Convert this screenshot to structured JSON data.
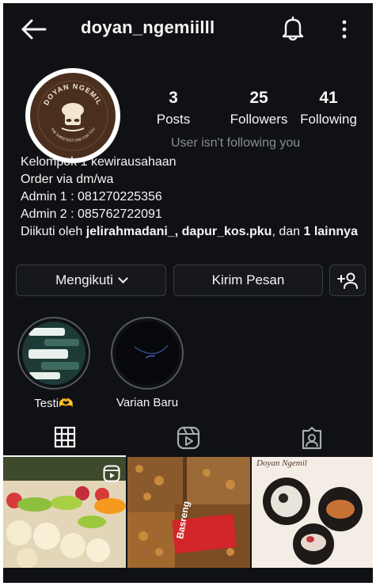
{
  "header": {
    "username": "doyan_ngemiilll",
    "icons": [
      "back-arrow-icon",
      "bell-icon",
      "more-vertical-icon"
    ]
  },
  "avatar": {
    "logo_text_top": "DOYAN NGEMIL",
    "logo_text_bottom": "THE SWEETEST ONE FOR YOU"
  },
  "stats": {
    "posts": {
      "value": "3",
      "label": "Posts"
    },
    "followers": {
      "value": "25",
      "label": "Followers"
    },
    "following": {
      "value": "41",
      "label": "Following"
    }
  },
  "follow_status": "User isn't following you",
  "bio": {
    "line1": "Kelompok 1 kewirausahaan",
    "line2": "Order via dm/wa",
    "line3": "Admin 1  : 081270225356",
    "line4": "Admin 2 : 085762722091",
    "followed_prefix": "Diikuti oleh ",
    "followed_users": "jelirahmadani_, dapur_kos.pku",
    "followed_mid": ", dan ",
    "followed_more": "1 lainnya"
  },
  "actions": {
    "follow_label": "Mengikuti",
    "message_label": "Kirim Pesan",
    "add_icon": "add-person-icon"
  },
  "highlights": [
    {
      "label": "Testi🫶"
    },
    {
      "label": "Varian Baru"
    }
  ],
  "tabs": [
    {
      "name": "grid",
      "icon": "grid-icon",
      "active": true
    },
    {
      "name": "reels",
      "icon": "reels-icon",
      "active": false
    },
    {
      "name": "tagged",
      "icon": "tagged-icon",
      "active": false
    }
  ],
  "posts": [
    {
      "kind": "reel",
      "icon": "reels-badge-icon"
    },
    {
      "kind": "photo",
      "brand_text": "Basreng"
    },
    {
      "kind": "photo",
      "brand_text": "Doyan Ngemil"
    }
  ],
  "colors": {
    "background": "#0f1114",
    "text": "#f5f5f5",
    "muted": "#8a8d92",
    "border": "#3a3d42"
  }
}
